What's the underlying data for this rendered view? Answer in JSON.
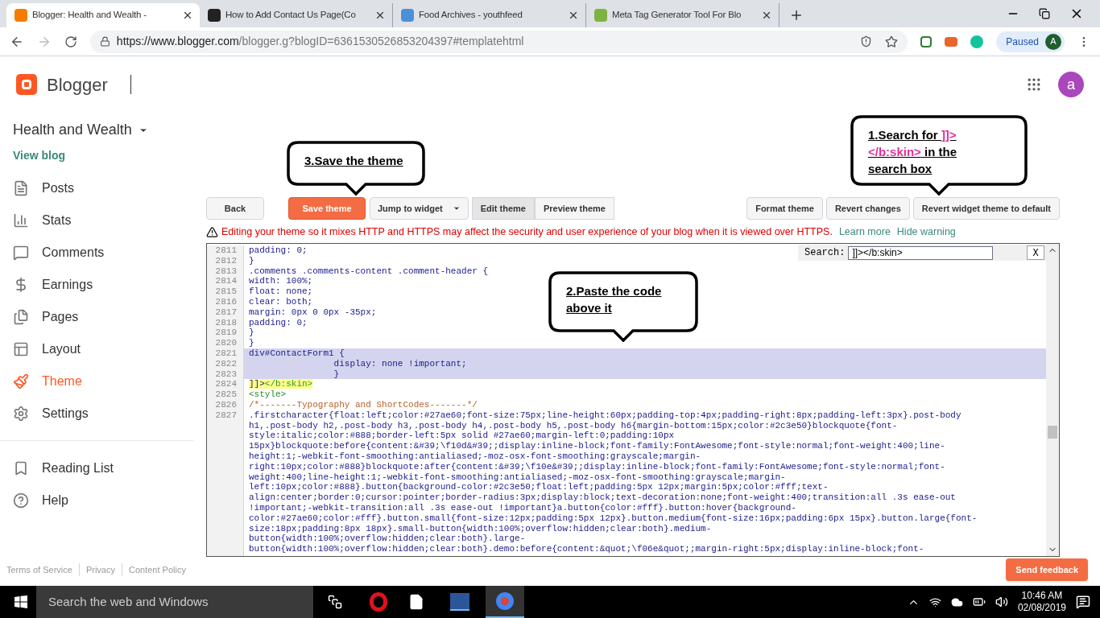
{
  "browser": {
    "tabs": [
      {
        "title": "Blogger: Health and Wealth -",
        "selected": true,
        "color": "#f57c00"
      },
      {
        "title": "How to Add Contact Us Page(Co",
        "selected": false,
        "color": "#222222"
      },
      {
        "title": "Food Archives - youthfeed",
        "selected": false,
        "color": "#4a90d9"
      },
      {
        "title": "Meta Tag Generator Tool For Blo",
        "selected": false,
        "color": "#7cb342"
      }
    ],
    "url_host": "https://www.blogger.com",
    "url_path": "/blogger.g?blogID=6361530526853204397#templatehtml",
    "profile_status": "Paused",
    "profile_initial": "A"
  },
  "app": {
    "name": "Blogger",
    "account_initial": "a"
  },
  "sidebar": {
    "blog_title": "Health and Wealth",
    "view_blog": "View blog",
    "items": [
      {
        "label": "Posts",
        "selected": false
      },
      {
        "label": "Stats",
        "selected": false
      },
      {
        "label": "Comments",
        "selected": false
      },
      {
        "label": "Earnings",
        "selected": false
      },
      {
        "label": "Pages",
        "selected": false
      },
      {
        "label": "Layout",
        "selected": false
      },
      {
        "label": "Theme",
        "selected": true
      },
      {
        "label": "Settings",
        "selected": false
      }
    ],
    "secondary": [
      {
        "label": "Reading List"
      },
      {
        "label": "Help"
      }
    ]
  },
  "footer_links": [
    "Terms of Service",
    "Privacy",
    "Content Policy"
  ],
  "toolbar": {
    "back": "Back",
    "save": "Save theme",
    "jump": "Jump to widget",
    "edit_tabs": [
      {
        "label": "Edit theme",
        "selected": true
      },
      {
        "label": "Preview theme",
        "selected": false
      }
    ],
    "right": [
      "Format theme",
      "Revert changes",
      "Revert widget theme to default"
    ]
  },
  "warning": {
    "text": "Editing your theme so it mixes HTTP and HTTPS may affect the security and user experience of your blog when it is viewed over HTTPS.",
    "learn_more": "Learn more",
    "hide": "Hide warning"
  },
  "editor": {
    "search": {
      "label": "Search:",
      "value": "]]></b:skin>",
      "close": "X"
    },
    "lines": [
      {
        "number": "2811",
        "selected": false,
        "segments": [
          {
            "text": "padding: 0;",
            "kind": "css"
          }
        ]
      },
      {
        "number": "2812",
        "selected": false,
        "segments": [
          {
            "text": "}",
            "kind": "css"
          }
        ]
      },
      {
        "number": "2813",
        "selected": false,
        "segments": [
          {
            "text": ".comments .comments-content .comment-header {",
            "kind": "css"
          }
        ]
      },
      {
        "number": "2814",
        "selected": false,
        "segments": [
          {
            "text": "width: 100%;",
            "kind": "css"
          }
        ]
      },
      {
        "number": "2815",
        "selected": false,
        "segments": [
          {
            "text": "float: none;",
            "kind": "css"
          }
        ]
      },
      {
        "number": "2816",
        "selected": false,
        "segments": [
          {
            "text": "clear: both;",
            "kind": "css"
          }
        ]
      },
      {
        "number": "2817",
        "selected": false,
        "segments": [
          {
            "text": "margin: 0px 0 0px -35px;",
            "kind": "css"
          }
        ]
      },
      {
        "number": "2818",
        "selected": false,
        "segments": [
          {
            "text": "padding: 0;",
            "kind": "css"
          }
        ]
      },
      {
        "number": "2819",
        "selected": false,
        "segments": [
          {
            "text": "}",
            "kind": "css"
          }
        ]
      },
      {
        "number": "2820",
        "selected": false,
        "segments": [
          {
            "text": "}",
            "kind": "css"
          }
        ]
      },
      {
        "number": "2821",
        "selected": true,
        "segments": [
          {
            "text": "div#ContactForm1 {",
            "kind": "css"
          }
        ]
      },
      {
        "number": "2822",
        "selected": true,
        "segments": [
          {
            "text": "                display: none !important;",
            "kind": "css"
          }
        ]
      },
      {
        "number": "2823",
        "selected": true,
        "segments": [
          {
            "text": "                }",
            "kind": "css"
          }
        ]
      },
      {
        "number": "2824",
        "selected": false,
        "segments": [
          {
            "text": "]]>",
            "kind": "match"
          },
          {
            "text": "</b:skin>",
            "kind": "match-tag"
          }
        ]
      },
      {
        "number": "2825",
        "selected": false,
        "segments": [
          {
            "text": "<style>",
            "kind": "tag"
          }
        ]
      },
      {
        "number": "2826",
        "selected": false,
        "segments": [
          {
            "text": "/*-------Typography and ShortCodes-------*/",
            "kind": "comment"
          }
        ]
      },
      {
        "number": "2827",
        "selected": false,
        "segments": [
          {
            "text": ".firstcharacter{float:left;color:#27ae60;font-size:75px;line-height:60px;padding-top:4px;padding-right:8px;padding-left:3px}.post-body\nh1,.post-body h2,.post-body h3,.post-body h4,.post-body h5,.post-body h6{margin-bottom:15px;color:#2c3e50}blockquote{font-\nstyle:italic;color:#888;border-left:5px solid #27ae60;margin-left:0;padding:10px\n15px}blockquote:before{content:&#39;\\f10d&#39;;display:inline-block;font-family:FontAwesome;font-style:normal;font-weight:400;line-\nheight:1;-webkit-font-smoothing:antialiased;-moz-osx-font-smoothing:grayscale;margin-\nright:10px;color:#888}blockquote:after{content:&#39;\\f10e&#39;;display:inline-block;font-family:FontAwesome;font-style:normal;font-\nweight:400;line-height:1;-webkit-font-smoothing:antialiased;-moz-osx-font-smoothing:grayscale;margin-\nleft:10px;color:#888}.button{background-color:#2c3e50;float:left;padding:5px 12px;margin:5px;color:#fff;text-\nalign:center;border:0;cursor:pointer;border-radius:3px;display:block;text-decoration:none;font-weight:400;transition:all .3s ease-out\n!important;-webkit-transition:all .3s ease-out !important}a.button{color:#fff}.button:hover{background-\ncolor:#27ae60;color:#fff}.button.small{font-size:12px;padding:5px 12px}.button.medium{font-size:16px;padding:6px 15px}.button.large{font-\nsize:18px;padding:8px 18px}.small-button{width:100%;overflow:hidden;clear:both}.medium-\nbutton{width:100%;overflow:hidden;clear:both}.large-\nbutton{width:100%;overflow:hidden;clear:both}.demo:before{content:&quot;\\f06e&quot;;margin-right:5px;display:inline-block;font-",
            "kind": "css"
          }
        ]
      }
    ]
  },
  "callout_save": {
    "parts": [
      {
        "text": "3.Save the theme",
        "kind": "plain"
      }
    ]
  },
  "callout_search": {
    "parts": [
      {
        "text": "1.Search for ",
        "kind": "plain"
      },
      {
        "text": "]]></b:skin>",
        "kind": "highlight"
      },
      {
        "text": " in the search box",
        "kind": "plain"
      }
    ]
  },
  "callout_paste": {
    "parts": [
      {
        "text": "2.Paste the code above it",
        "kind": "plain"
      }
    ]
  },
  "feedback": "Send feedback",
  "taskbar": {
    "search_placeholder": "Search the web and Windows",
    "time": "10:46 AM",
    "date": "02/08/2019"
  }
}
